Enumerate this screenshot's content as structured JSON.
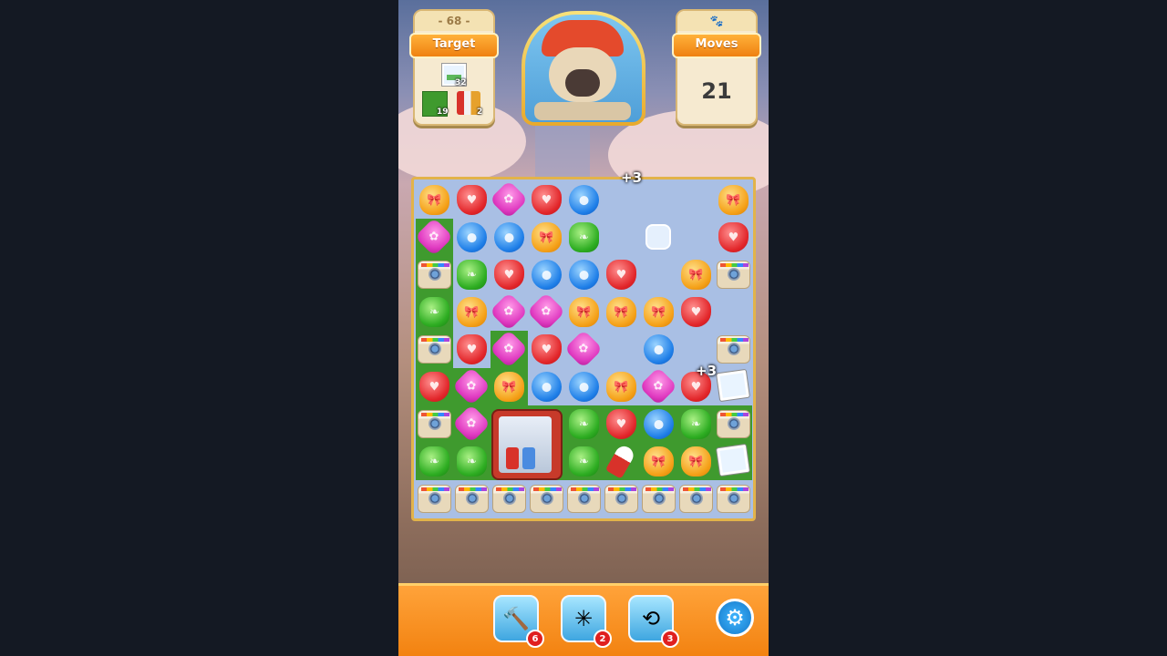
{
  "level": {
    "number": "- 68 -"
  },
  "target": {
    "label": "Target",
    "items": [
      {
        "name": "photo",
        "count": "32"
      },
      {
        "name": "grass",
        "count": "19"
      },
      {
        "name": "fridge",
        "count": "2"
      }
    ]
  },
  "moves": {
    "label": "Moves",
    "value": "21",
    "icon": "paw-icon"
  },
  "avatar": {
    "name": "pug-character"
  },
  "floating_text": [
    "+3",
    "+3"
  ],
  "board": {
    "rows": [
      [
        "orange",
        "red",
        "pink",
        "red",
        "blue",
        "blank",
        "blank",
        "blank",
        "orange"
      ],
      [
        "pink",
        "blue",
        "blue",
        "orange",
        "green",
        "blank",
        "ice",
        "blank",
        "red"
      ],
      [
        "camera",
        "green",
        "red",
        "blue",
        "blue",
        "red",
        "blank",
        "orange",
        "camera"
      ],
      [
        "green",
        "orange",
        "pink",
        "pink",
        "orange",
        "orange",
        "orange",
        "red",
        "blank"
      ],
      [
        "camera",
        "red",
        "pink",
        "red",
        "pink",
        "blank",
        "blue",
        "blank",
        "camera"
      ],
      [
        "red",
        "pink",
        "orange",
        "blue",
        "blue",
        "orange",
        "pink",
        "red",
        "photo"
      ],
      [
        "camera",
        "pink",
        "fridge",
        "fridge",
        "green",
        "red",
        "blue",
        "green",
        "camera"
      ],
      [
        "green",
        "green",
        "fridge",
        "fridge",
        "green",
        "rocket",
        "orange",
        "orange",
        "photo"
      ],
      [
        "camera",
        "camera",
        "camera",
        "camera",
        "camera",
        "camera",
        "camera",
        "camera",
        "camera"
      ]
    ],
    "grass": [
      [
        0,
        0,
        0,
        0,
        0,
        0,
        0,
        0,
        0
      ],
      [
        1,
        0,
        0,
        0,
        0,
        0,
        0,
        0,
        0
      ],
      [
        1,
        0,
        0,
        0,
        0,
        0,
        0,
        0,
        0
      ],
      [
        1,
        0,
        0,
        0,
        0,
        0,
        0,
        0,
        0
      ],
      [
        1,
        0,
        1,
        0,
        0,
        0,
        0,
        0,
        0
      ],
      [
        1,
        1,
        1,
        0,
        0,
        0,
        0,
        0,
        0
      ],
      [
        1,
        1,
        1,
        1,
        1,
        1,
        1,
        1,
        1
      ],
      [
        1,
        1,
        1,
        1,
        1,
        1,
        1,
        1,
        1
      ],
      [
        0,
        0,
        0,
        0,
        0,
        0,
        0,
        0,
        0
      ]
    ]
  },
  "boosters": [
    {
      "name": "hammer",
      "symbol": "🔨",
      "count": "6"
    },
    {
      "name": "pinwheel",
      "symbol": "✳",
      "count": "2"
    },
    {
      "name": "swap",
      "symbol": "⟲",
      "count": "3"
    }
  ],
  "settings": {
    "symbol": "⚙"
  }
}
